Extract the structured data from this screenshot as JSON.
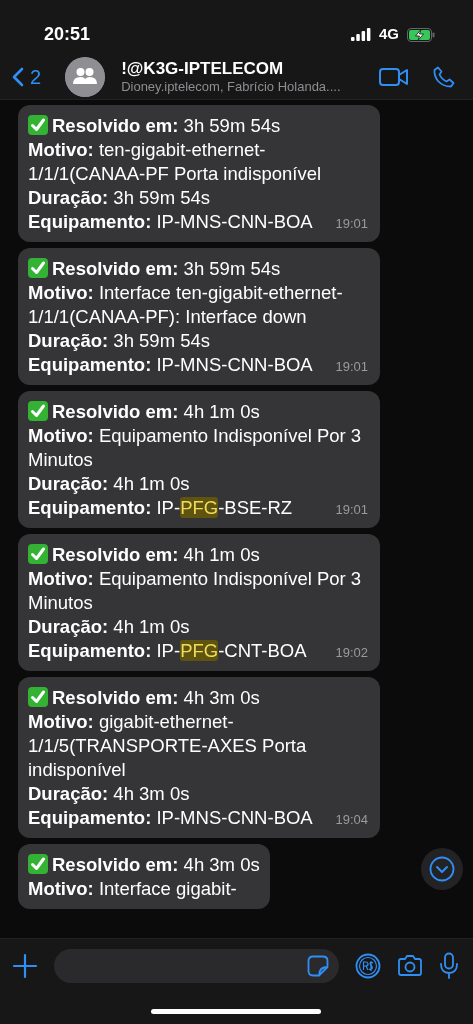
{
  "status_bar": {
    "time": "20:51",
    "network": "4G"
  },
  "header": {
    "back_count": "2",
    "title": "!@K3G-IPTELECOM",
    "subtitle": "Dioney.iptelecom, Fabrício Holanda...."
  },
  "messages": [
    {
      "time": "19:01",
      "lines": [
        {
          "label": "Resolvido em:",
          "parts": [
            {
              "text": "3h 59m 54s",
              "highlighted": false
            }
          ]
        },
        {
          "label": "Motivo:",
          "parts": [
            {
              "text": "ten-gigabit-ethernet-1/1/1(CANAA-PF Porta indisponível",
              "highlighted": false
            }
          ]
        },
        {
          "label": "Duração:",
          "parts": [
            {
              "text": "3h 59m 54s",
              "highlighted": false
            }
          ]
        },
        {
          "label": "Equipamento:",
          "parts": [
            {
              "text": "IP-MNS-CNN-BOA",
              "highlighted": false
            }
          ]
        }
      ]
    },
    {
      "time": "19:01",
      "lines": [
        {
          "label": "Resolvido em:",
          "parts": [
            {
              "text": "3h 59m 54s",
              "highlighted": false
            }
          ]
        },
        {
          "label": "Motivo:",
          "parts": [
            {
              "text": "Interface ten-gigabit-ethernet-1/1/1(CANAA-PF): Interface down",
              "highlighted": false
            }
          ]
        },
        {
          "label": "Duração:",
          "parts": [
            {
              "text": "3h 59m 54s",
              "highlighted": false
            }
          ]
        },
        {
          "label": "Equipamento:",
          "parts": [
            {
              "text": "IP-MNS-CNN-BOA",
              "highlighted": false
            }
          ]
        }
      ]
    },
    {
      "time": "19:01",
      "lines": [
        {
          "label": "Resolvido em:",
          "parts": [
            {
              "text": "4h 1m 0s",
              "highlighted": false
            }
          ]
        },
        {
          "label": "Motivo:",
          "parts": [
            {
              "text": "Equipamento Indisponível Por 3 Minutos",
              "highlighted": false
            }
          ]
        },
        {
          "label": "Duração:",
          "parts": [
            {
              "text": "4h 1m 0s",
              "highlighted": false
            }
          ]
        },
        {
          "label": "Equipamento:",
          "parts": [
            {
              "text": "IP-",
              "highlighted": false
            },
            {
              "text": "PFG",
              "highlighted": true
            },
            {
              "text": "-BSE-RZ",
              "highlighted": false
            }
          ]
        }
      ]
    },
    {
      "time": "19:02",
      "lines": [
        {
          "label": "Resolvido em:",
          "parts": [
            {
              "text": "4h 1m 0s",
              "highlighted": false
            }
          ]
        },
        {
          "label": "Motivo:",
          "parts": [
            {
              "text": "Equipamento Indisponível Por 3 Minutos",
              "highlighted": false
            }
          ]
        },
        {
          "label": "Duração:",
          "parts": [
            {
              "text": "4h 1m 0s",
              "highlighted": false
            }
          ]
        },
        {
          "label": "Equipamento:",
          "parts": [
            {
              "text": "IP-",
              "highlighted": false
            },
            {
              "text": "PFG",
              "highlighted": true
            },
            {
              "text": "-CNT-BOA",
              "highlighted": false
            }
          ]
        }
      ]
    },
    {
      "time": "19:04",
      "lines": [
        {
          "label": "Resolvido em:",
          "parts": [
            {
              "text": "4h 3m 0s",
              "highlighted": false
            }
          ]
        },
        {
          "label": "Motivo:",
          "parts": [
            {
              "text": "gigabit-ethernet-1/1/5(TRANSPORTE-AXES Porta indisponível",
              "highlighted": false
            }
          ]
        },
        {
          "label": "Duração:",
          "parts": [
            {
              "text": "4h 3m 0s",
              "highlighted": false
            }
          ]
        },
        {
          "label": "Equipamento:",
          "parts": [
            {
              "text": "IP-MNS-CNN-BOA",
              "highlighted": false
            }
          ]
        }
      ]
    },
    {
      "lines": [
        {
          "label": "Resolvido em:",
          "parts": [
            {
              "text": "4h 3m 0s",
              "highlighted": false
            }
          ]
        },
        {
          "label": "Motivo:",
          "parts": [
            {
              "text": "Interface gigabit-",
              "highlighted": false
            }
          ]
        }
      ]
    }
  ]
}
